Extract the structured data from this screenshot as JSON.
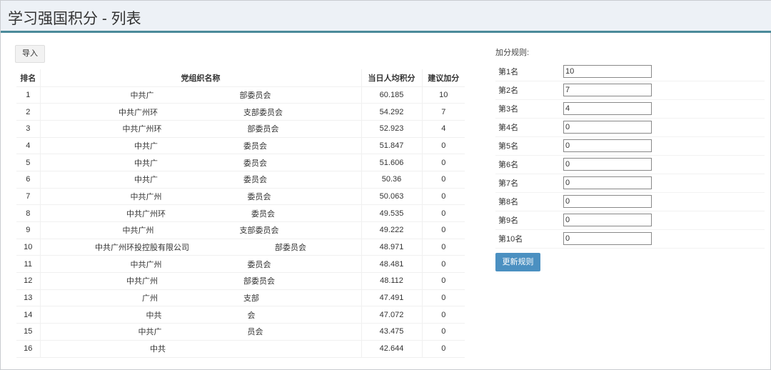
{
  "header": {
    "title": "学习强国积分 - 列表"
  },
  "toolbar": {
    "import_label": "导入"
  },
  "table": {
    "columns": [
      "排名",
      "党组织名称",
      "当日人均积分",
      "建议加分"
    ],
    "rows": [
      {
        "rank": "1",
        "name_left": "中共广",
        "name_right": "部委员会",
        "score": "60.185",
        "bonus": "10"
      },
      {
        "rank": "2",
        "name_left": "中共广州环",
        "name_right": "支部委员会",
        "score": "54.292",
        "bonus": "7"
      },
      {
        "rank": "3",
        "name_left": "中共广州环",
        "name_right": "部委员会",
        "score": "52.923",
        "bonus": "4"
      },
      {
        "rank": "4",
        "name_left": "中共广",
        "name_right": "委员会",
        "score": "51.847",
        "bonus": "0"
      },
      {
        "rank": "5",
        "name_left": "中共广",
        "name_right": "委员会",
        "score": "51.606",
        "bonus": "0"
      },
      {
        "rank": "6",
        "name_left": "中共广",
        "name_right": "委员会",
        "score": "50.36",
        "bonus": "0"
      },
      {
        "rank": "7",
        "name_left": "中共广州",
        "name_right": "委员会",
        "score": "50.063",
        "bonus": "0"
      },
      {
        "rank": "8",
        "name_left": "中共广州环",
        "name_right": "委员会",
        "score": "49.535",
        "bonus": "0"
      },
      {
        "rank": "9",
        "name_left": "中共广州",
        "name_right": "支部委员会",
        "score": "49.222",
        "bonus": "0"
      },
      {
        "rank": "10",
        "name_left": "中共广州环投控股有限公司",
        "name_right": "部委员会",
        "score": "48.971",
        "bonus": "0"
      },
      {
        "rank": "11",
        "name_left": "中共广州",
        "name_right": "委员会",
        "score": "48.481",
        "bonus": "0"
      },
      {
        "rank": "12",
        "name_left": "中共广州",
        "name_right": "部委员会",
        "score": "48.112",
        "bonus": "0"
      },
      {
        "rank": "13",
        "name_left": "广州",
        "name_right": "支部",
        "score": "47.491",
        "bonus": "0"
      },
      {
        "rank": "14",
        "name_left": "中共",
        "name_right": "会",
        "score": "47.072",
        "bonus": "0"
      },
      {
        "rank": "15",
        "name_left": "中共广",
        "name_right": "员会",
        "score": "43.475",
        "bonus": "0"
      },
      {
        "rank": "16",
        "name_left": "中共",
        "name_right": "",
        "score": "42.644",
        "bonus": "0"
      }
    ]
  },
  "rules": {
    "label": "加分规则:",
    "items": [
      {
        "label": "第1名",
        "value": "10"
      },
      {
        "label": "第2名",
        "value": "7"
      },
      {
        "label": "第3名",
        "value": "4"
      },
      {
        "label": "第4名",
        "value": "0"
      },
      {
        "label": "第5名",
        "value": "0"
      },
      {
        "label": "第6名",
        "value": "0"
      },
      {
        "label": "第7名",
        "value": "0"
      },
      {
        "label": "第8名",
        "value": "0"
      },
      {
        "label": "第9名",
        "value": "0"
      },
      {
        "label": "第10名",
        "value": "0"
      }
    ],
    "update_label": "更新规则"
  },
  "colors": {
    "accent": "#4b90c1",
    "header_line": "#4b8a9a",
    "header_bg": "#edf1f6"
  }
}
